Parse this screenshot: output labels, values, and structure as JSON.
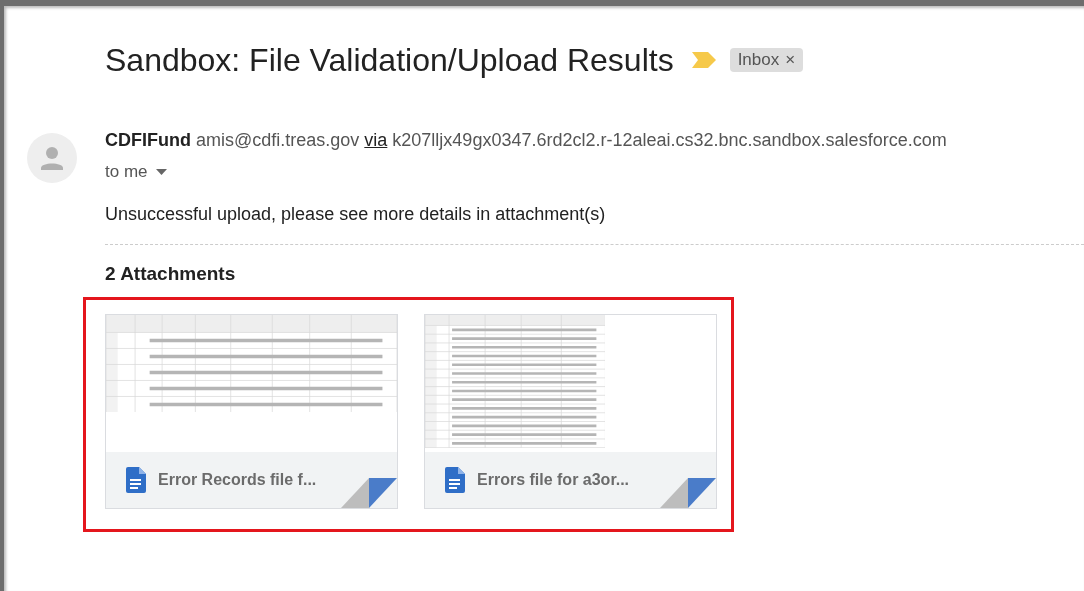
{
  "subject": {
    "title": "Sandbox: File Validation/Upload Results",
    "important": true,
    "label": {
      "text": "Inbox",
      "remove": "×"
    }
  },
  "sender": {
    "name": "CDFIFund",
    "email": "amis@cdfi.treas.gov",
    "via": "via",
    "domain": "k207lljx49gx0347.6rd2cl2.r-12aleai.cs32.bnc.sandbox.salesforce.com",
    "recipient": "to me"
  },
  "body": "Unsuccessful upload, please see more details in attachment(s)",
  "attachments": {
    "heading": "2 Attachments",
    "highlighted": true,
    "items": [
      {
        "name": "Error Records file f..."
      },
      {
        "name": "Errors file for a3or..."
      }
    ]
  }
}
